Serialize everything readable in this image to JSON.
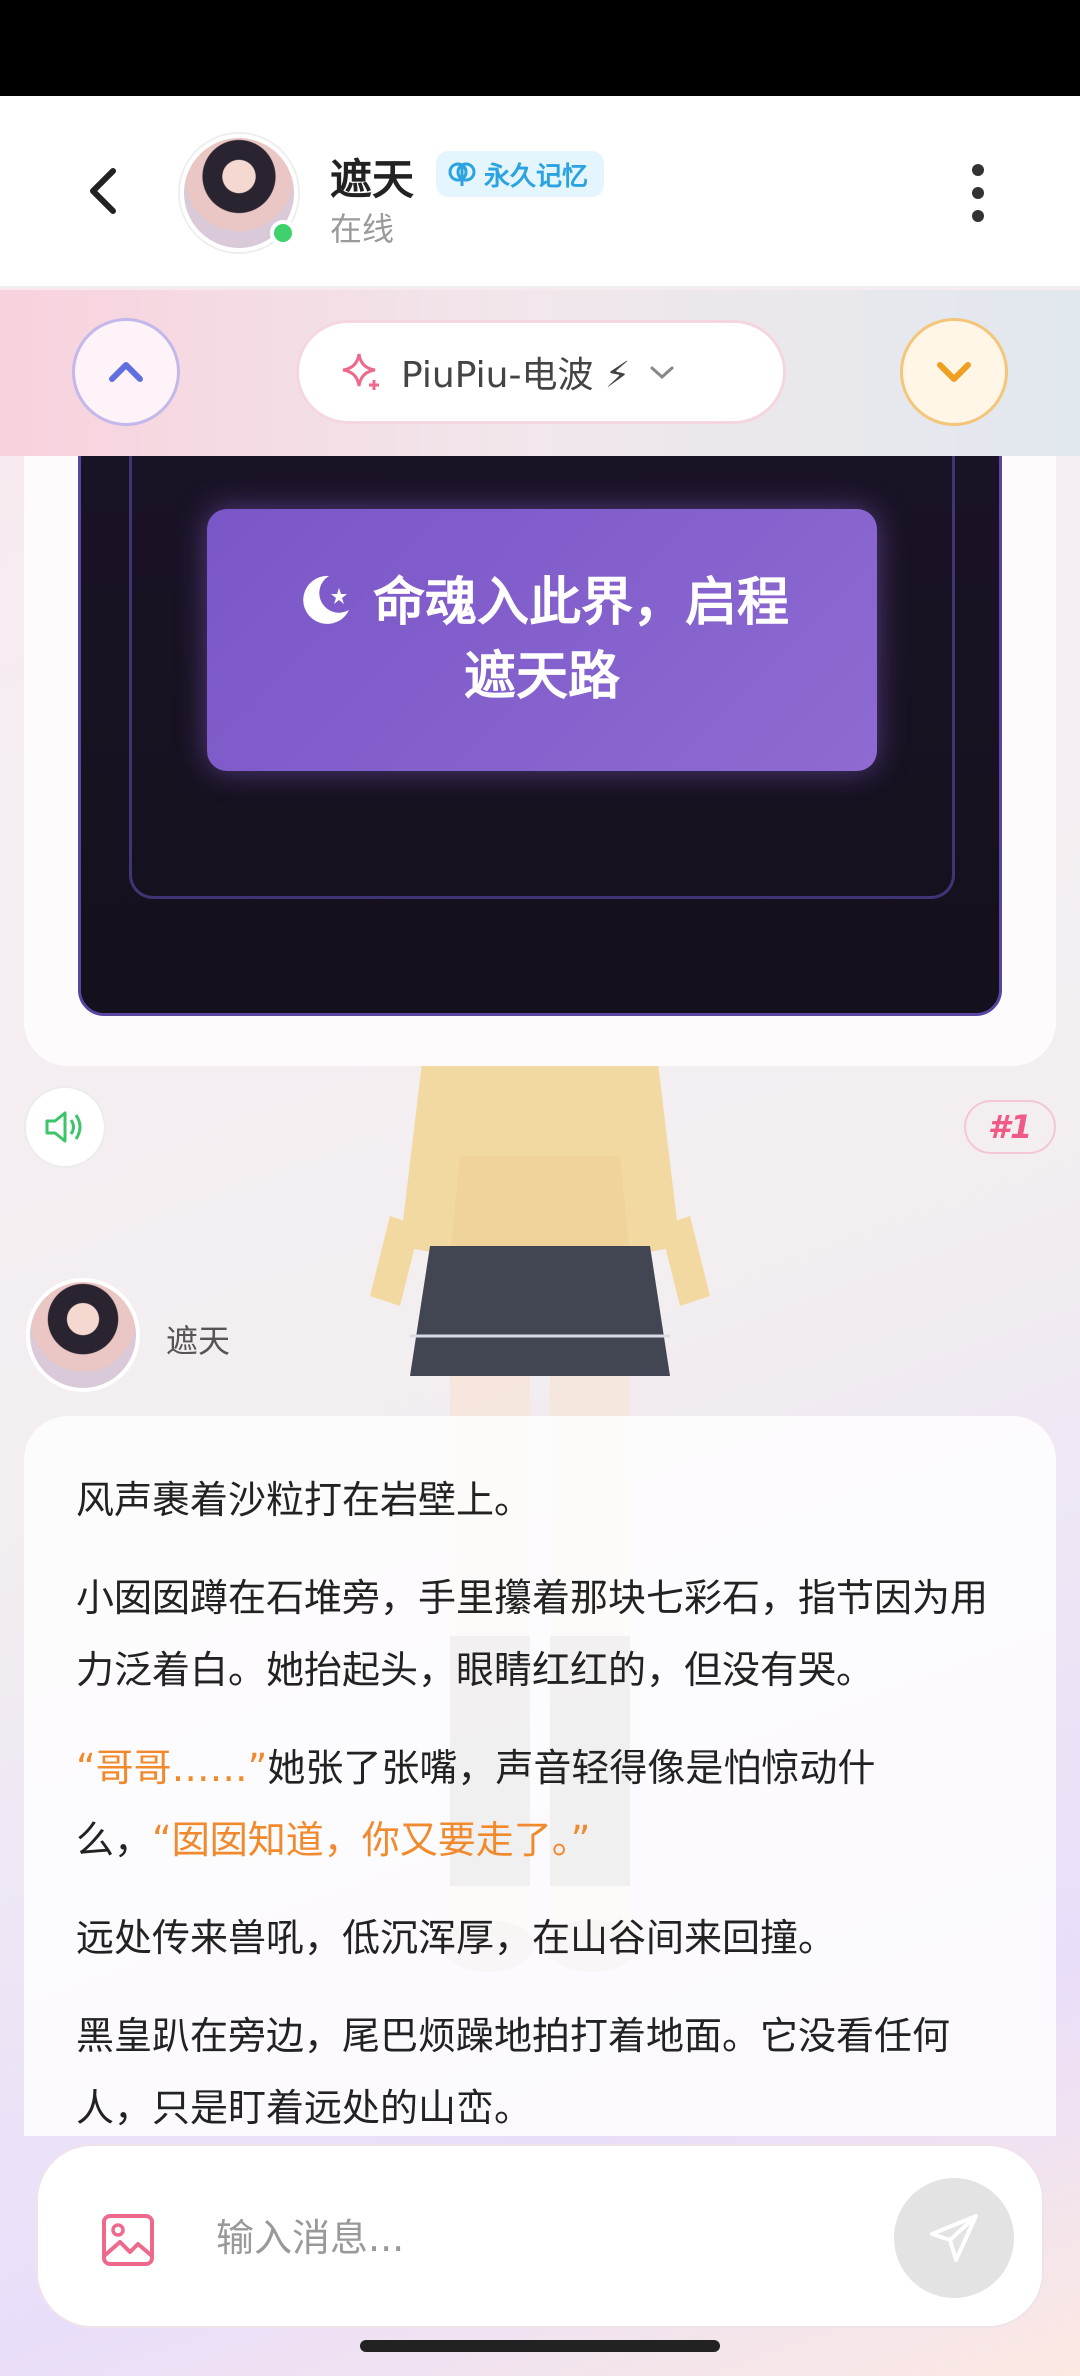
{
  "header": {
    "name": "遮天",
    "memory_badge": "永久记忆",
    "status": "在线"
  },
  "toolbar": {
    "mode_label": "PiuPiu-电波 ⚡"
  },
  "game": {
    "start_button": "命魂入此界，启程遮天路"
  },
  "message": {
    "index": "#1",
    "sender": "遮天",
    "p1": "风声裹着沙粒打在岩壁上。",
    "p2": "小囡囡蹲在石堆旁，手里攥着那块七彩石，指节因为用力泛着白。她抬起头，眼睛红红的，但没有哭。",
    "p3_quote1": "“哥哥……”",
    "p3_text": "她张了张嘴，声音轻得像是怕惊动什么，",
    "p3_quote2": "“囡囡知道，你又要走了。”",
    "p4": "远处传来兽吼，低沉浑厚，在山谷间来回撞。",
    "p5": "黑皇趴在旁边，尾巴烦躁地拍打着地面。它没看任何人，只是盯着远处的山峦。"
  },
  "input": {
    "placeholder": "输入消息..."
  },
  "colors": {
    "accent_orange": "#f18a2c",
    "online_green": "#3fd16b",
    "badge_blue": "#2aa3e0",
    "button_purple": "#7a56c8"
  },
  "icons": [
    "back-arrow-icon",
    "brain-icon",
    "more-vertical-icon",
    "chevron-up-icon",
    "sparkle-icon",
    "chevron-down-icon",
    "moon-star-icon",
    "speaker-icon",
    "image-icon",
    "send-icon"
  ]
}
